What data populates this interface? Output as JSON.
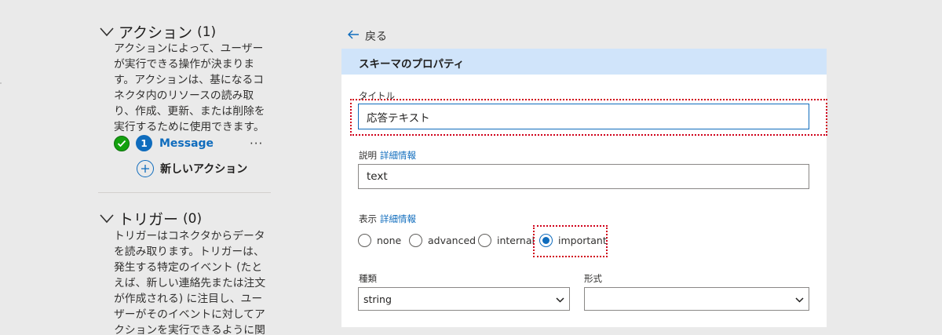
{
  "actions": {
    "title": "アクション",
    "count": "(1)",
    "description": "アクションによって、ユーザーが実行できる操作が決まります。アクションは、基になるコネクタ内のリソースの読み取り、作成、更新、または削除を実行するために使用できます。",
    "item": {
      "number": "1",
      "label": "Message",
      "more": "···"
    },
    "new_action_label": "新しいアクション"
  },
  "triggers": {
    "title": "トリガー",
    "count": "(0)",
    "description": "トリガーはコネクタからデータを読み取ります。トリガーは、発生する特定のイベント (たとえば、新しい連絡先または注文が作成される) に注目し、ユーザーがそのイベントに対してアクションを実行できるように関連データを提供します。"
  },
  "back_label": "戻る",
  "panel": {
    "title": "スキーマのプロパティ",
    "title_field": {
      "label": "タイトル",
      "value": "応答テキスト"
    },
    "description_field": {
      "label": "説明",
      "link": "詳細情報",
      "value": "text"
    },
    "visibility": {
      "label": "表示",
      "link": "詳細情報",
      "options": [
        "none",
        "advanced",
        "internal",
        "important"
      ],
      "selected": "important"
    },
    "type_field": {
      "label": "種類",
      "value": "string"
    },
    "format_field": {
      "label": "形式",
      "value": ""
    }
  },
  "colors": {
    "accent": "#0f6cbd",
    "highlight": "#d0021b",
    "header_bg": "#d0e4fa",
    "success": "#13a10e"
  }
}
